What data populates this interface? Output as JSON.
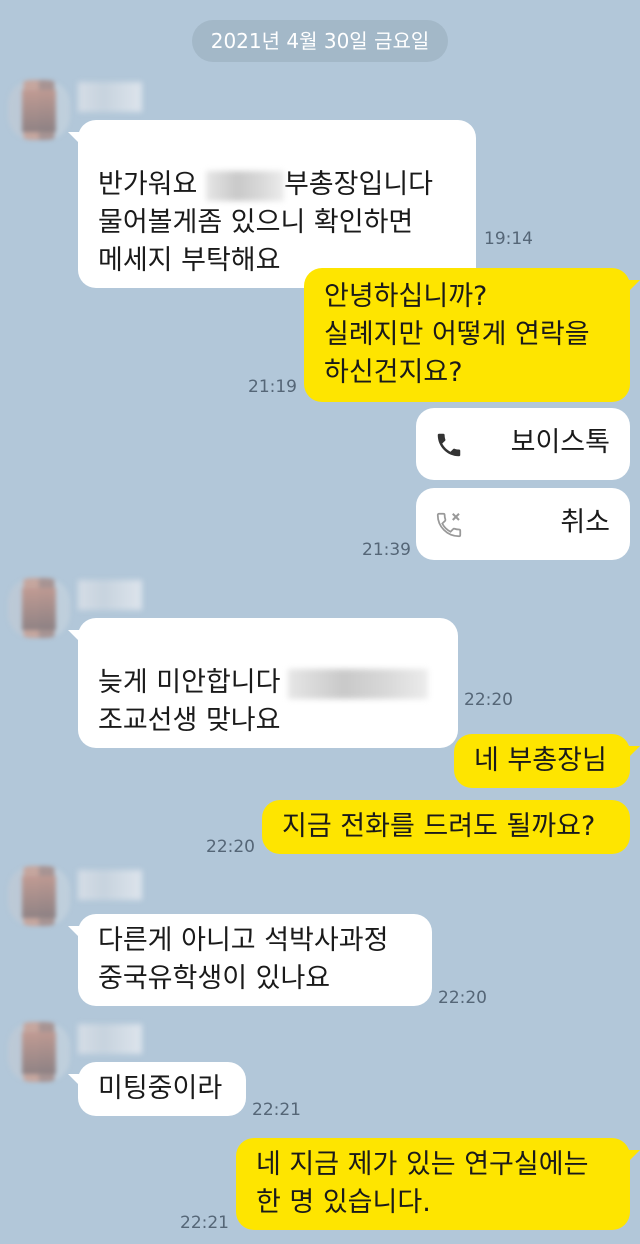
{
  "date_divider": "2021년 4월 30일 금요일",
  "messages": [
    {
      "side": "in",
      "lines": "반가워요 [blurred]부총장입니다\n물어볼게좀 있으니 확인하면\n메세지 부탁해요",
      "l1a": "반가워요 ",
      "l1b": "부총장입니다",
      "rest": "물어볼게좀 있으니 확인하면\n메세지 부탁해요",
      "time": "19:14"
    },
    {
      "side": "out",
      "text": "안녕하십니까?\n실례지만 어떻게 연락을\n하신건지요?",
      "time": "21:19"
    },
    {
      "call_voice": "보이스톡",
      "call_cancel": "취소",
      "time": "21:39"
    },
    {
      "side": "in",
      "l1": "늦게 미안합니다",
      "l2": "조교선생 맞나요",
      "time": "22:20"
    },
    {
      "side": "out",
      "text": "네 부총장님"
    },
    {
      "side": "out",
      "text": "지금 전화를 드려도 될까요?",
      "time": "22:20"
    },
    {
      "side": "in",
      "text": "다른게 아니고 석박사과정\n중국유학생이 있나요",
      "time": "22:20"
    },
    {
      "side": "in",
      "text": "미팅중이라",
      "time": "22:21"
    },
    {
      "side": "out",
      "text": "네 지금 제가 있는 연구실에는\n한 명 있습니다.",
      "time": "22:21"
    }
  ],
  "colors": {
    "background": "#b2c7d9",
    "outgoing": "#fee500",
    "incoming": "#ffffff"
  },
  "icons": [
    "phone-icon",
    "phone-missed-icon"
  ]
}
